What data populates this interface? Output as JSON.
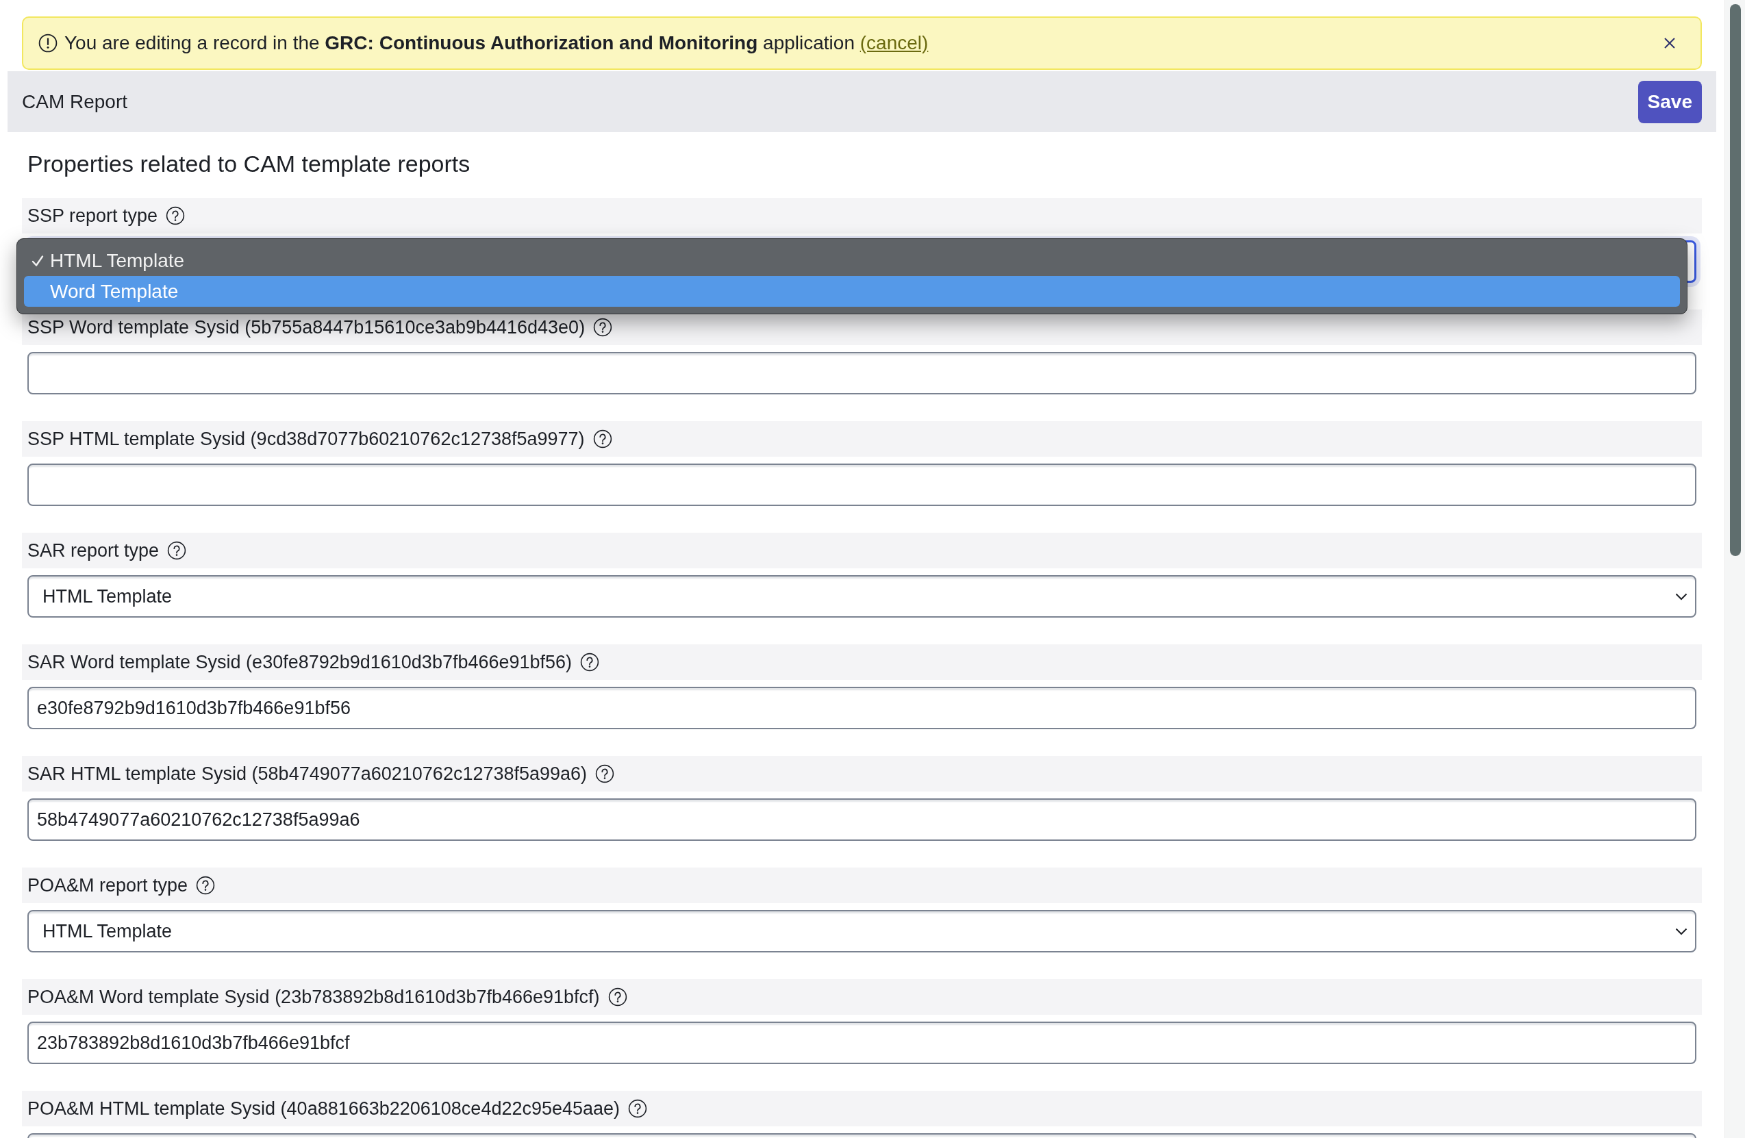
{
  "notice": {
    "message": "You are editing a record in the **GRC: Continuous Authorization and Monitoring** application",
    "link": "(cancel)"
  },
  "form_header": {
    "title": "CAM Report",
    "save_button": "Save"
  },
  "section_title": "Properties related to CAM template reports",
  "fields": [
    {
      "kind": "select",
      "label": "SSP report type",
      "focused": true,
      "open_options": [
        {
          "label": "HTML Template",
          "selected": true,
          "highlighted": false
        },
        {
          "label": "Word Template",
          "selected": false,
          "highlighted": true
        }
      ]
    },
    {
      "kind": "text",
      "label": "SSP Word template Sysid (5b755a8447b15610ce3ab9b4416d43e0)",
      "focused": false
    },
    {
      "kind": "text",
      "label": "SSP HTML template Sysid (9cd38d7077b60210762c12738f5a9977)",
      "focused": false
    },
    {
      "kind": "select",
      "label": "SAR report type",
      "focused": false,
      "value": "HTML Template"
    },
    {
      "kind": "text",
      "label": "SAR Word template Sysid (e30fe8792b9d1610d3b7fb466e91bf56)",
      "focused": false,
      "value": "e30fe8792b9d1610d3b7fb466e91bf56"
    },
    {
      "kind": "text",
      "label": "SAR HTML template Sysid (58b4749077a60210762c12738f5a99a6)",
      "focused": false,
      "value": "58b4749077a60210762c12738f5a99a6"
    },
    {
      "kind": "select",
      "label": "POA&M report type",
      "focused": false,
      "value": "HTML Template"
    },
    {
      "kind": "text",
      "label": "POA&M Word template Sysid (23b783892b8d1610d3b7fb466e91bfcf)",
      "focused": false,
      "value": "23b783892b8d1610d3b7fb466e91bfcf"
    },
    {
      "kind": "text",
      "label": "POA&M HTML template Sysid (40a881663b2206108ce4d22c95e45aae)",
      "focused": false
    }
  ]
}
